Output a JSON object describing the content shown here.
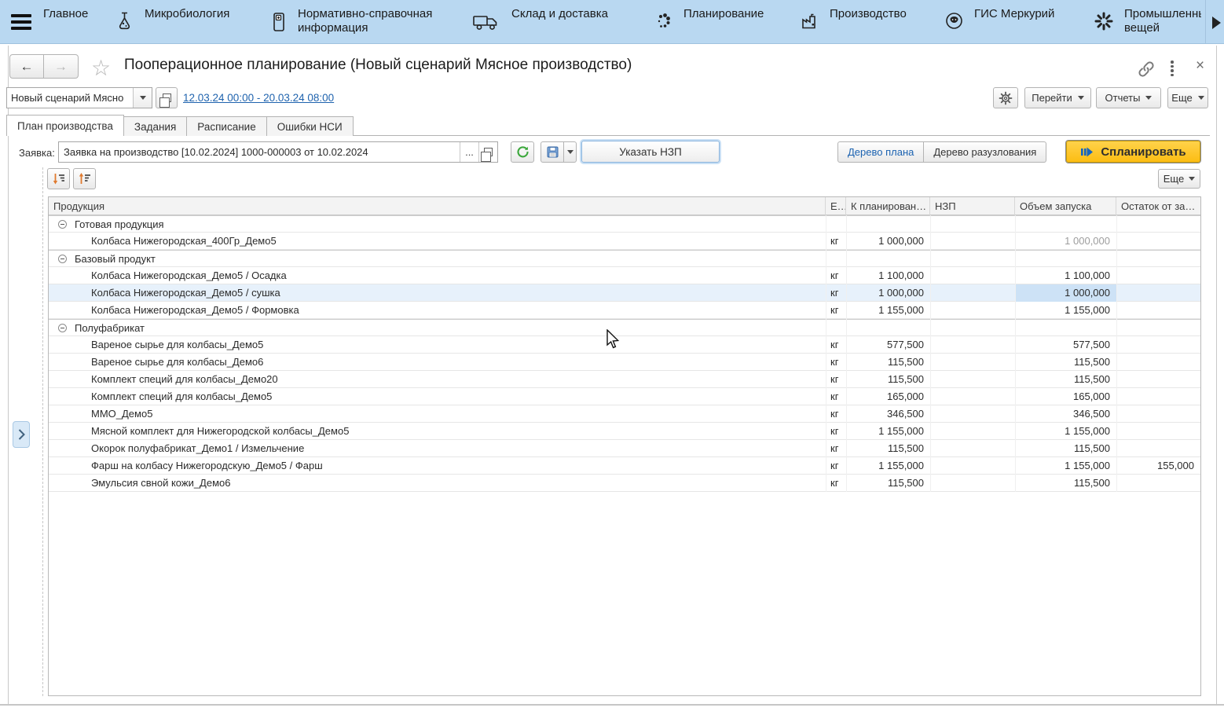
{
  "colors": {
    "navbar": "#b9d8f1",
    "link": "#1f63ae",
    "plan_button": "#fcbd13",
    "selection_row": "#e7f1fb",
    "selection_cell": "#cde2f6"
  },
  "nav": {
    "items": [
      {
        "label": "Главное"
      },
      {
        "label": "Микробиология",
        "icon": "flask-icon"
      },
      {
        "label": "Нормативно-справочная информация",
        "icon": "document-icon"
      },
      {
        "label": "Склад и доставка",
        "icon": "truck-icon"
      },
      {
        "label": "Планирование",
        "icon": "dots-icon"
      },
      {
        "label": "Производство",
        "icon": "factory-icon"
      },
      {
        "label": "ГИС Меркурий",
        "icon": "mercury-icon"
      },
      {
        "label": "Промышленны\nвещей",
        "icon": "iot-icon"
      }
    ]
  },
  "header": {
    "title": "Пооперационное планирование (Новый сценарий Мясное производство)",
    "back": "←",
    "forward": "→",
    "star": "☆",
    "close": "×",
    "scenario_value": "Новый сценарий Мясно",
    "period_link": "12.03.24 00:00 - 20.03.24 08:00",
    "goto_label": "Перейти",
    "reports_label": "Отчеты",
    "more_label": "Еще"
  },
  "tabs": [
    {
      "label": "План производства",
      "active": true
    },
    {
      "label": "Задания",
      "active": false
    },
    {
      "label": "Расписание",
      "active": false
    },
    {
      "label": "Ошибки НСИ",
      "active": false
    }
  ],
  "toolbar": {
    "request_label": "Заявка:",
    "request_value": "Заявка на производство [10.02.2024] 1000-000003 от 10.02.2024",
    "ellipsis_label": "...",
    "specify_wip_label": "Указать НЗП",
    "plan_tree_label": "Дерево плана",
    "explosion_tree_label": "Дерево разузлования",
    "plan_label": "Спланировать",
    "more_label": "Еще"
  },
  "table": {
    "columns": [
      "Продукция",
      "Е…",
      "К планирован…",
      "НЗП",
      "Объем запуска",
      "Остаток от за…"
    ],
    "rows": [
      {
        "type": "group",
        "name": "Готовая продукция"
      },
      {
        "type": "item",
        "name": "Колбаса Нижегородская_400Гр_Демо5",
        "unit": "кг",
        "to_plan": "1 000,000",
        "launch": "1 000,000",
        "launch_muted": true
      },
      {
        "type": "group",
        "name": "Базовый продукт"
      },
      {
        "type": "item",
        "name": "Колбаса Нижегородская_Демо5 / Осадка",
        "unit": "кг",
        "to_plan": "1 100,000",
        "launch": "1 100,000"
      },
      {
        "type": "item",
        "name": "Колбаса Нижегородская_Демо5 / сушка",
        "unit": "кг",
        "to_plan": "1 000,000",
        "launch": "1 000,000",
        "selected": true
      },
      {
        "type": "item",
        "name": "Колбаса Нижегородская_Демо5 / Формовка",
        "unit": "кг",
        "to_plan": "1 155,000",
        "launch": "1 155,000"
      },
      {
        "type": "group",
        "name": "Полуфабрикат"
      },
      {
        "type": "item",
        "name": "Вареное сырье для колбасы_Демо5",
        "unit": "кг",
        "to_plan": "577,500",
        "launch": "577,500"
      },
      {
        "type": "item",
        "name": "Вареное сырье для колбасы_Демо6",
        "unit": "кг",
        "to_plan": "115,500",
        "launch": "115,500"
      },
      {
        "type": "item",
        "name": "Комплект специй для колбасы_Демо20",
        "unit": "кг",
        "to_plan": "115,500",
        "launch": "115,500"
      },
      {
        "type": "item",
        "name": "Комплект специй для колбасы_Демо5",
        "unit": "кг",
        "to_plan": "165,000",
        "launch": "165,000"
      },
      {
        "type": "item",
        "name": "ММО_Демо5",
        "unit": "кг",
        "to_plan": "346,500",
        "launch": "346,500"
      },
      {
        "type": "item",
        "name": "Мясной комплект для Нижегородской колбасы_Демо5",
        "unit": "кг",
        "to_plan": "1 155,000",
        "launch": "1 155,000"
      },
      {
        "type": "item",
        "name": "Окорок полуфабрикат_Демо1 / Измельчение",
        "unit": "кг",
        "to_plan": "115,500",
        "launch": "115,500"
      },
      {
        "type": "item",
        "name": "Фарш на колбасу Нижегородскую_Демо5 / Фарш",
        "unit": "кг",
        "to_plan": "1 155,000",
        "launch": "1 155,000",
        "remainder": "155,000"
      },
      {
        "type": "item",
        "name": "Эмульсия свной кожи_Демо6",
        "unit": "кг",
        "to_plan": "115,500",
        "launch": "115,500"
      }
    ]
  }
}
